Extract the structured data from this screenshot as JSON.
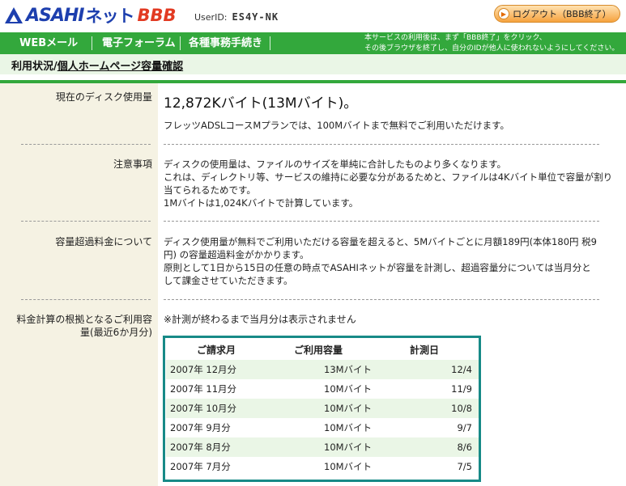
{
  "header": {
    "logo": {
      "asahi": "ASAHI",
      "net": "ネット",
      "bbb": "BBB"
    },
    "userid_label": "UserID:",
    "userid_value": "ES4Y-NK",
    "logout_label": "ログアウト（BBB終了）"
  },
  "nav": {
    "items": [
      "WEBメール",
      "電子フォーラム",
      "各種事務手続き"
    ],
    "note_line1": "本サービスの利用後は、まず「BBB終了」をクリック、",
    "note_line2": "その後ブラウザを終了し、自分のIDが他人に使われないようにしてください。"
  },
  "breadcrumb": {
    "parent": "利用状況/",
    "current": "個人ホームページ容量確認"
  },
  "sections": {
    "disk": {
      "label": "現在のディスク使用量",
      "value": "12,872Kバイト(13Mバイト)。",
      "note": "フレッツADSLコースMプランでは、100Mバイトまで無料でご利用いただけます。"
    },
    "caution": {
      "label": "注意事項",
      "line1": "ディスクの使用量は、ファイルのサイズを単純に合計したものより多くなります。",
      "line2": "これは、ディレクトリ等、サービスの維持に必要な分があるためと、ファイルは4Kバイト単位で容量が割り",
      "line3": "当てられるためです。",
      "line4": "1Mバイトは1,024Kバイトで計算しています。"
    },
    "overage": {
      "label": "容量超過料金について",
      "line1": "ディスク使用量が無料でご利用いただける容量を超えると、5Mバイトごとに月額189円(本体180円 税9",
      "line2": "円) の容量超過料金がかかります。",
      "line3": "原則として1日から15日の任意の時点でASAHIネットが容量を計測し、超過容量分については当月分と",
      "line4": "して課金させていただきます。"
    },
    "basis": {
      "label_line1": "料金計算の根拠となるご利用容",
      "label_line2": "量(最近6か月分)",
      "note": "※計測が終わるまで当月分は表示されません"
    }
  },
  "table": {
    "headers": [
      "ご請求月",
      "ご利用容量",
      "計測日"
    ],
    "rows": [
      [
        "2007年 12月分",
        "13Mバイト",
        "12/4"
      ],
      [
        "2007年 11月分",
        "10Mバイト",
        "11/9"
      ],
      [
        "2007年 10月分",
        "10Mバイト",
        "10/8"
      ],
      [
        "2007年 9月分",
        "10Mバイト",
        "9/7"
      ],
      [
        "2007年 8月分",
        "10Mバイト",
        "8/6"
      ],
      [
        "2007年 7月分",
        "10Mバイト",
        "7/5"
      ]
    ]
  },
  "colors": {
    "brand_blue": "#1d3fae",
    "brand_red": "#e23a22",
    "nav_green": "#33a83c",
    "table_border": "#178a87",
    "row_alt": "#eaf6e6"
  }
}
